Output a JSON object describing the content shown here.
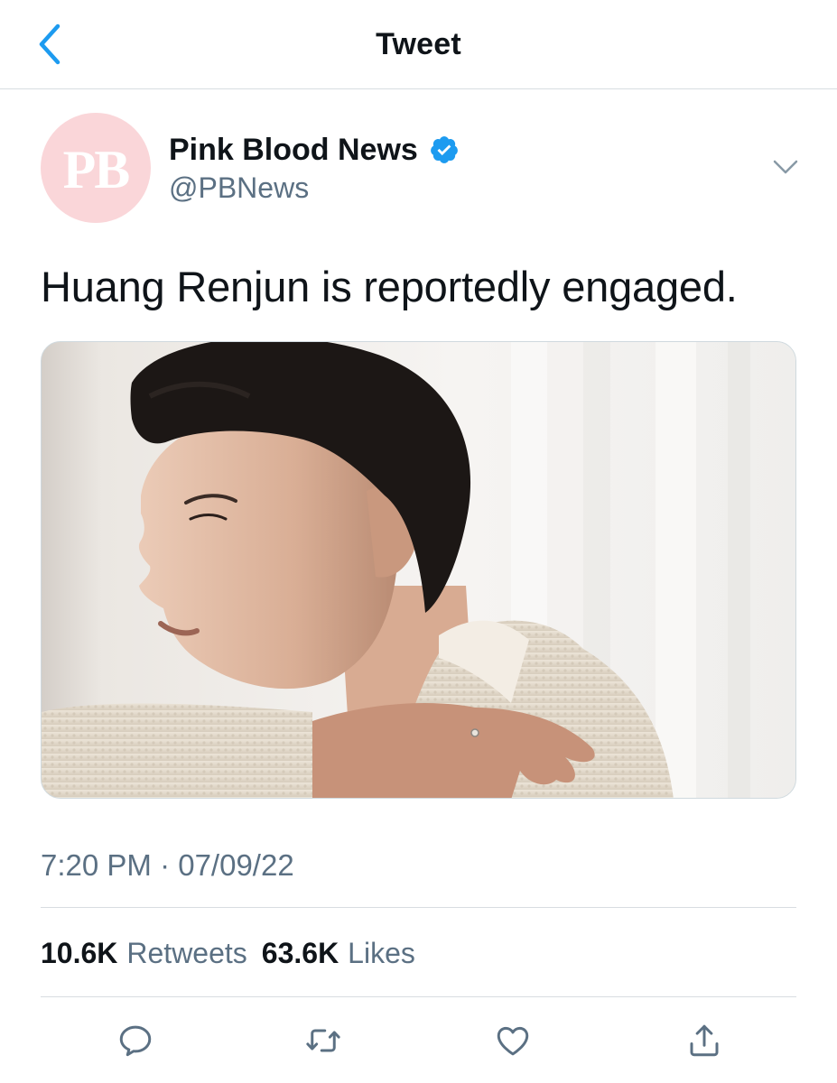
{
  "header": {
    "title": "Tweet",
    "back_icon": "chevron-left-icon"
  },
  "author": {
    "avatar_text": "PB",
    "display_name": "Pink Blood News",
    "handle": "@PBNews",
    "verified": true
  },
  "tweet": {
    "text": "Huang Renjun is reportedly engaged.",
    "timestamp": "7:20 PM · 07/09/22"
  },
  "stats": {
    "retweets_count": "10.6K",
    "retweets_label": "Retweets",
    "likes_count": "63.6K",
    "likes_label": "Likes"
  },
  "actions": [
    "reply-icon",
    "retweet-icon",
    "like-icon",
    "share-icon"
  ],
  "colors": {
    "accent": "#1d9bf0",
    "secondary_text": "#5b7083",
    "avatar_bg": "#fad6d9",
    "divider": "#d8dde1"
  }
}
